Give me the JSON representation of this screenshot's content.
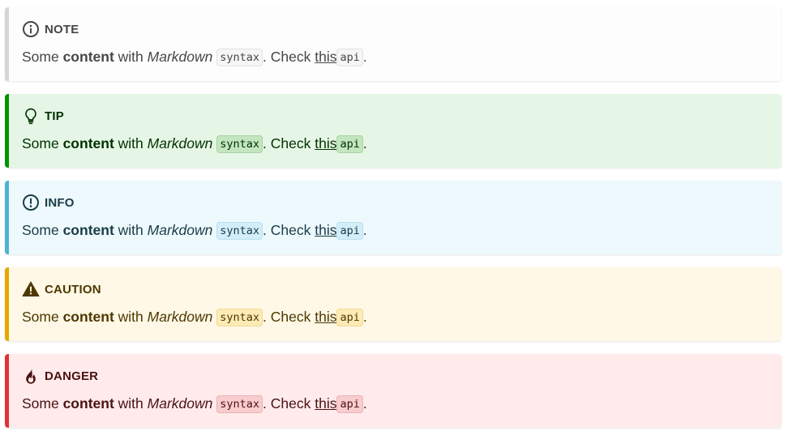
{
  "admonitions": [
    {
      "kind": "note",
      "title": "NOTE",
      "icon": "info-circle-icon",
      "accent": "#d4d5d8",
      "text_some": "Some ",
      "text_bold": "content",
      "text_with": " with ",
      "text_italic": "Markdown",
      "text_space": " ",
      "code1": "syntax",
      "text_check": ". Check ",
      "link": "this",
      "code2": "api",
      "text_end": "."
    },
    {
      "kind": "tip",
      "title": "TIP",
      "icon": "lightbulb-icon",
      "accent": "#009400",
      "text_some": "Some ",
      "text_bold": "content",
      "text_with": " with ",
      "text_italic": "Markdown",
      "text_space": " ",
      "code1": "syntax",
      "text_check": ". Check ",
      "link": "this",
      "code2": "api",
      "text_end": "."
    },
    {
      "kind": "info",
      "title": "INFO",
      "icon": "exclamation-circle-icon",
      "accent": "#4cb3d4",
      "text_some": "Some ",
      "text_bold": "content",
      "text_with": " with ",
      "text_italic": "Markdown",
      "text_space": " ",
      "code1": "syntax",
      "text_check": ". Check ",
      "link": "this",
      "code2": "api",
      "text_end": "."
    },
    {
      "kind": "caution",
      "title": "CAUTION",
      "icon": "warning-triangle-icon",
      "accent": "#e6a700",
      "text_some": "Some ",
      "text_bold": "content",
      "text_with": " with ",
      "text_italic": "Markdown",
      "text_space": " ",
      "code1": "syntax",
      "text_check": ". Check ",
      "link": "this",
      "code2": "api",
      "text_end": "."
    },
    {
      "kind": "danger",
      "title": "DANGER",
      "icon": "flame-icon",
      "accent": "#e13238",
      "text_some": "Some ",
      "text_bold": "content",
      "text_with": " with ",
      "text_italic": "Markdown",
      "text_space": " ",
      "code1": "syntax",
      "text_check": ". Check ",
      "link": "this",
      "code2": "api",
      "text_end": "."
    }
  ]
}
